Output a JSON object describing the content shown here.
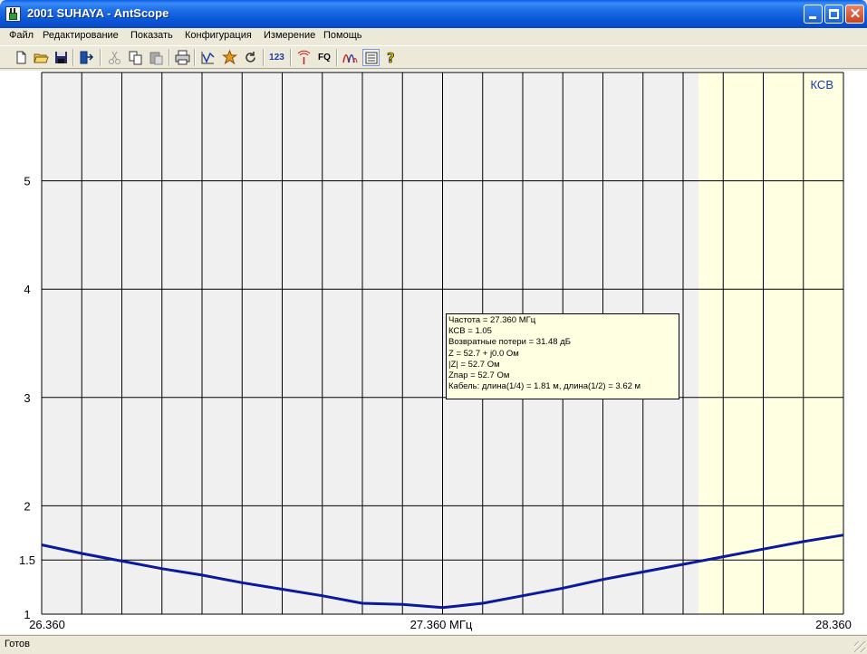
{
  "window": {
    "title": "2001 SUHAYA - AntScope"
  },
  "menu": [
    "Файл",
    "Редактирование",
    "Показать",
    "Конфигурация",
    "Измерение",
    "Помощь"
  ],
  "toolbar": {
    "buttons": [
      "new-file-icon",
      "open-folder-icon",
      "save-icon",
      "exit-icon",
      "cut-icon",
      "copy-icon",
      "paste-icon",
      "print-icon",
      "graph-icon",
      "star-icon",
      "refresh-icon",
      "numbers-icon",
      "antenna-icon",
      "fq-icon",
      "waves-icon",
      "list-icon",
      "help-icon"
    ],
    "numbers_label": "123",
    "fq_label": "FQ"
  },
  "chart_data": {
    "type": "line",
    "title": "КСВ",
    "x_unit": "МГц",
    "xlim": [
      26.36,
      28.36
    ],
    "ylim": [
      1,
      6
    ],
    "x_tick_labels": [
      "26.360",
      "27.360 МГц",
      "28.360"
    ],
    "y_ticks": [
      1,
      1.5,
      2,
      3,
      4,
      5
    ],
    "y_tick_labels": [
      "1",
      "1.5",
      "2",
      "3",
      "4",
      "5"
    ],
    "grid": true,
    "line_color": "#0a1a9a",
    "highlight_band_color": "#ffffe1",
    "series": [
      {
        "x": [
          26.36,
          26.46,
          26.56,
          26.66,
          26.76,
          26.86,
          26.96,
          27.06,
          27.16,
          27.26,
          27.36,
          27.46,
          27.56,
          27.66,
          27.76,
          27.86,
          27.96,
          28.06,
          28.16,
          28.26,
          28.36
        ],
        "y": [
          1.64,
          1.56,
          1.49,
          1.42,
          1.36,
          1.29,
          1.23,
          1.17,
          1.1,
          1.09,
          1.06,
          1.1,
          1.17,
          1.24,
          1.32,
          1.39,
          1.46,
          1.53,
          1.6,
          1.67,
          1.73
        ]
      }
    ]
  },
  "infobox": {
    "lines": [
      "Частота = 27.360 МГц",
      "КСВ = 1.05",
      "Возвратные потери = 31.48 дБ",
      "Z = 52.7 + j0.0 Ом",
      "|Z| = 52.7 Ом",
      "Zпар = 52.7 Ом",
      "Кабель: длина(1/4) = 1.81 м, длина(1/2) = 3.62 м"
    ]
  },
  "status": {
    "text": "Готов"
  }
}
